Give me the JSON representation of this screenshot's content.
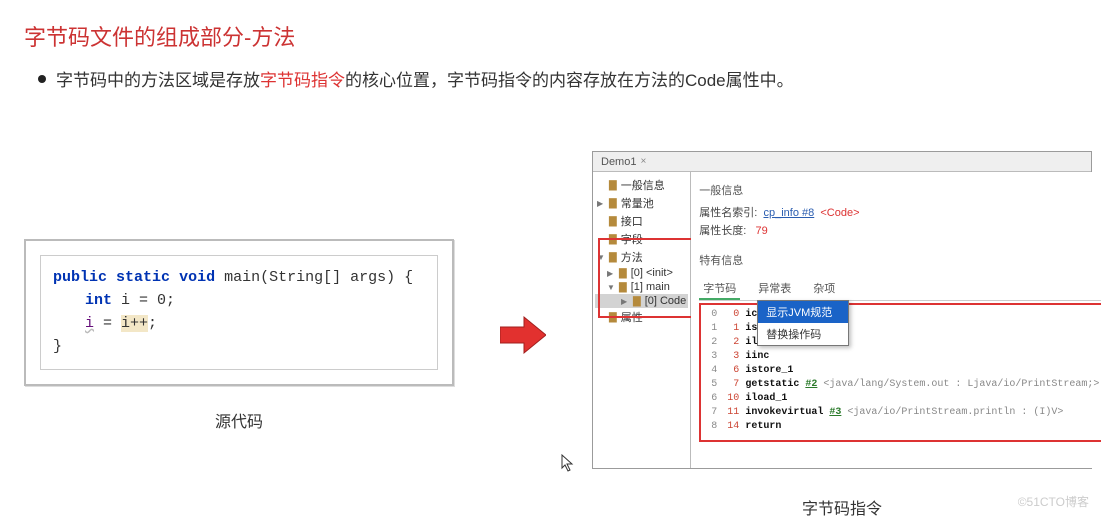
{
  "title": "字节码文件的组成部分-方法",
  "bullet": {
    "pre": "字节码中的方法区域是存放",
    "red": "字节码指令",
    "post": "的核心位置，字节码指令的内容存放在方法的Code属性中。"
  },
  "source": {
    "l1_kw1": "public",
    "l1_kw2": "static",
    "l1_kw3": "void",
    "l1_rest": " main(String[] args) {",
    "l2_kw": "int",
    "l2_rest": " i = ",
    "l2_num": "0",
    "l2_semi": ";",
    "l3_var": "i",
    "l3_mid": " = ",
    "l3_warn": "i++",
    "l3_semi": ";",
    "l4": "}"
  },
  "label_source": "源代码",
  "label_bytecode": "字节码指令",
  "tab": {
    "name": "Demo1",
    "x": "×"
  },
  "tree": {
    "t0": "一般信息",
    "t1": "常量池",
    "t2": "接口",
    "t3": "字段",
    "t4": "方法",
    "t5": "[0] <init>",
    "t6": "[1] main",
    "t7": "[0] Code",
    "t8": "属性"
  },
  "info": {
    "sect": "一般信息",
    "prop1_lbl": "属性名索引:",
    "prop1_link": "cp_info #8",
    "prop1_tag": "<Code>",
    "prop2_lbl": "属性长度:",
    "prop2_val": "79",
    "spec": "特有信息"
  },
  "tabs2": {
    "a": "字节码",
    "b": "异常表",
    "c": "杂项"
  },
  "bytecode": [
    {
      "n": "0",
      "pc": "0",
      "op": "iconst_0",
      "rest": ""
    },
    {
      "n": "1",
      "pc": "1",
      "op": "istore_1",
      "rest": ""
    },
    {
      "n": "2",
      "pc": "2",
      "op": "iload_1",
      "rest": ""
    },
    {
      "n": "3",
      "pc": "3",
      "op": "iinc",
      "rest": ""
    },
    {
      "n": "4",
      "pc": "6",
      "op": "istore_1",
      "rest": ""
    },
    {
      "n": "5",
      "pc": "7",
      "op": "getstatic",
      "ref": "#2",
      "cmt": " <java/lang/System.out : Ljava/io/PrintStream;>"
    },
    {
      "n": "6",
      "pc": "10",
      "op": "iload_1",
      "rest": ""
    },
    {
      "n": "7",
      "pc": "11",
      "op": "invokevirtual",
      "ref": "#3",
      "cmt": " <java/io/PrintStream.println : (I)V>"
    },
    {
      "n": "8",
      "pc": "14",
      "op": "return",
      "rest": ""
    }
  ],
  "ctx": {
    "a": "显示JVM规范",
    "b": "替换操作码"
  },
  "watermark": "©51CTO博客"
}
